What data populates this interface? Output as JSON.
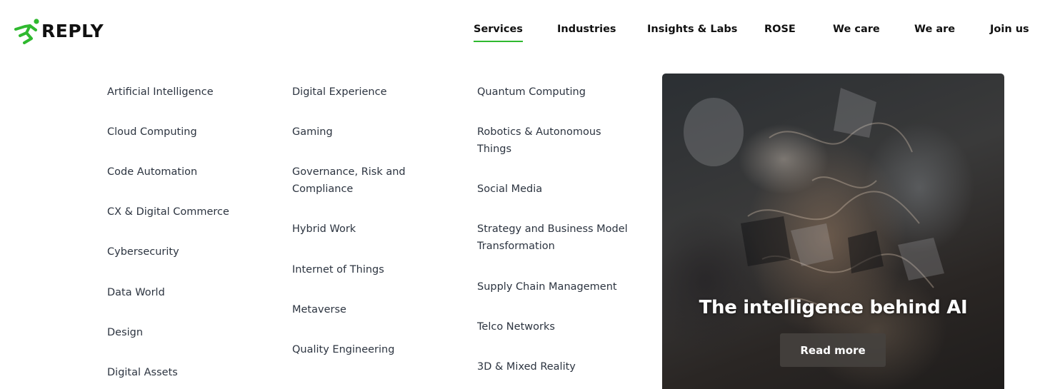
{
  "brand": {
    "name": "REPLY",
    "accent": "#2fb92f"
  },
  "nav": {
    "items": [
      {
        "label": "Services",
        "active": true
      },
      {
        "label": "Industries"
      },
      {
        "label": "Insights & Labs"
      },
      {
        "label": "ROSE"
      },
      {
        "label": "We care"
      },
      {
        "label": "We are"
      },
      {
        "label": "Join us"
      }
    ]
  },
  "menu": {
    "column1": [
      "Artificial Intelligence",
      "Cloud Computing",
      "Code Automation",
      "CX & Digital Commerce",
      "Cybersecurity",
      "Data World",
      "Design",
      "Digital Assets"
    ],
    "column2": [
      "Digital Experience",
      "Gaming",
      "Governance, Risk and Compliance",
      "Hybrid Work",
      "Internet of Things",
      "Metaverse",
      "Quality Engineering"
    ],
    "column3": [
      "Quantum Computing",
      "Robotics & Autonomous Things",
      "Social Media",
      "Strategy and Business Model Transformation",
      "Supply Chain Management",
      "Telco Networks",
      "3D & Mixed Reality"
    ]
  },
  "promo": {
    "title": "The intelligence behind AI",
    "button_label": "Read more"
  }
}
